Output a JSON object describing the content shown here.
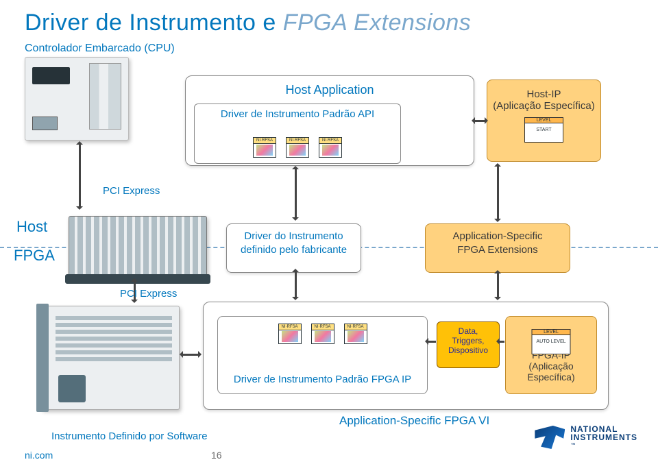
{
  "title": {
    "a": "Driver de Instrumento e ",
    "b": "FPGA Extensions"
  },
  "cpu_label": "Controlador Embarcado (CPU)",
  "host_app": {
    "title": "Host Application",
    "api": "Driver de Instrumento Padrão API"
  },
  "host_ip": {
    "line1": "Host-IP",
    "line2": "(Aplicação Específica)",
    "chip_hdr": "LEVEL",
    "chip_body": "START"
  },
  "pcie": "PCI Express",
  "side": {
    "host": "Host",
    "fpga": "FPGA"
  },
  "mid": {
    "left_l1": "Driver do Instrumento",
    "left_l2": "definido pelo fabricante",
    "right_l1": "Application-Specific",
    "right_l2": "FPGA Extensions"
  },
  "ipbox": "Driver de Instrumento Padrão FPGA IP",
  "databox": {
    "l1": "Data,",
    "l2": "Triggers,",
    "l3": "Dispositivo"
  },
  "fpga_ip": {
    "line1": "FPGA-IP",
    "line2": "(Aplicação Específica)",
    "chip_hdr": "LEVEL",
    "chip_body": "AUTO LEVEL"
  },
  "asfpga": "Application-Specific FPGA VI",
  "instr_def": "Instrumento Definido por Software",
  "footer": {
    "site": "ni.com",
    "page": "16"
  },
  "logo": {
    "l1": "NATIONAL",
    "l2": "INSTRUMENTS"
  },
  "mini_hdr": "NI·RFSA"
}
